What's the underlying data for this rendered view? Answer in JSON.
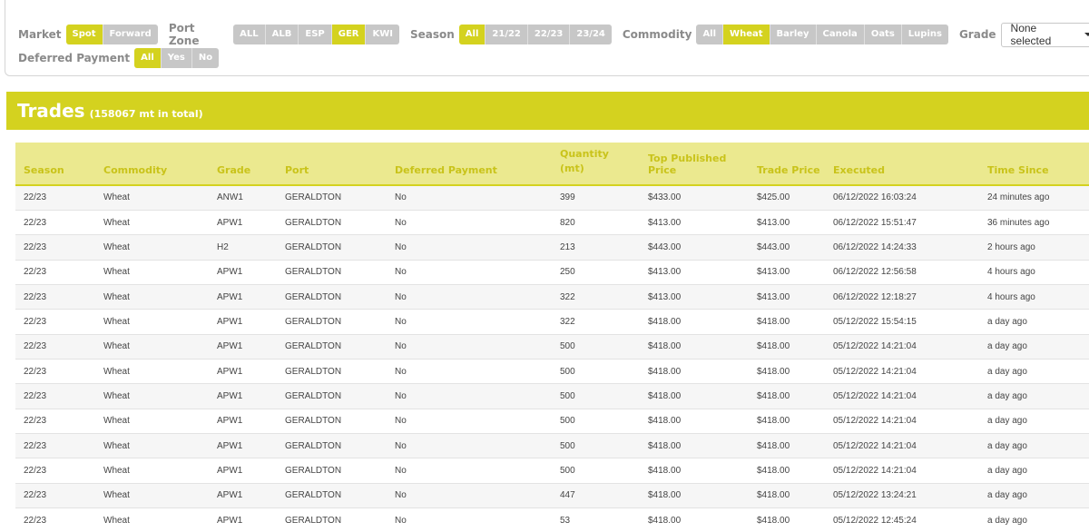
{
  "filters": {
    "market": {
      "label": "Market",
      "options": [
        "Spot",
        "Forward"
      ],
      "active": "Spot"
    },
    "port_zone": {
      "label": "Port Zone",
      "options": [
        "ALL",
        "ALB",
        "ESP",
        "GER",
        "KWI"
      ],
      "active": "GER"
    },
    "season": {
      "label": "Season",
      "options": [
        "All",
        "21/22",
        "22/23",
        "23/24"
      ],
      "active": "All"
    },
    "commodity": {
      "label": "Commodity",
      "options": [
        "All",
        "Wheat",
        "Barley",
        "Canola",
        "Oats",
        "Lupins"
      ],
      "active": "Wheat"
    },
    "grade": {
      "label": "Grade",
      "selected": "None selected"
    },
    "deferred_payment": {
      "label": "Deferred Payment",
      "options": [
        "All",
        "Yes",
        "No"
      ],
      "active": "All"
    }
  },
  "trades": {
    "title": "Trades",
    "subtitle": "(158067 mt in total)",
    "columns": [
      "Season",
      "Commodity",
      "Grade",
      "Port",
      "Deferred Payment",
      "Quantity (mt)",
      "Top Published Price",
      "Trade Price",
      "Executed",
      "Time Since"
    ],
    "rows": [
      [
        "22/23",
        "Wheat",
        "ANW1",
        "GERALDTON",
        "No",
        "399",
        "$433.00",
        "$425.00",
        "06/12/2022 16:03:24",
        "24 minutes ago"
      ],
      [
        "22/23",
        "Wheat",
        "APW1",
        "GERALDTON",
        "No",
        "820",
        "$413.00",
        "$413.00",
        "06/12/2022 15:51:47",
        "36 minutes ago"
      ],
      [
        "22/23",
        "Wheat",
        "H2",
        "GERALDTON",
        "No",
        "213",
        "$443.00",
        "$443.00",
        "06/12/2022 14:24:33",
        "2 hours ago"
      ],
      [
        "22/23",
        "Wheat",
        "APW1",
        "GERALDTON",
        "No",
        "250",
        "$413.00",
        "$413.00",
        "06/12/2022 12:56:58",
        "4 hours ago"
      ],
      [
        "22/23",
        "Wheat",
        "APW1",
        "GERALDTON",
        "No",
        "322",
        "$413.00",
        "$413.00",
        "06/12/2022 12:18:27",
        "4 hours ago"
      ],
      [
        "22/23",
        "Wheat",
        "APW1",
        "GERALDTON",
        "No",
        "322",
        "$418.00",
        "$418.00",
        "05/12/2022 15:54:15",
        "a day ago"
      ],
      [
        "22/23",
        "Wheat",
        "APW1",
        "GERALDTON",
        "No",
        "500",
        "$418.00",
        "$418.00",
        "05/12/2022 14:21:04",
        "a day ago"
      ],
      [
        "22/23",
        "Wheat",
        "APW1",
        "GERALDTON",
        "No",
        "500",
        "$418.00",
        "$418.00",
        "05/12/2022 14:21:04",
        "a day ago"
      ],
      [
        "22/23",
        "Wheat",
        "APW1",
        "GERALDTON",
        "No",
        "500",
        "$418.00",
        "$418.00",
        "05/12/2022 14:21:04",
        "a day ago"
      ],
      [
        "22/23",
        "Wheat",
        "APW1",
        "GERALDTON",
        "No",
        "500",
        "$418.00",
        "$418.00",
        "05/12/2022 14:21:04",
        "a day ago"
      ],
      [
        "22/23",
        "Wheat",
        "APW1",
        "GERALDTON",
        "No",
        "500",
        "$418.00",
        "$418.00",
        "05/12/2022 14:21:04",
        "a day ago"
      ],
      [
        "22/23",
        "Wheat",
        "APW1",
        "GERALDTON",
        "No",
        "500",
        "$418.00",
        "$418.00",
        "05/12/2022 14:21:04",
        "a day ago"
      ],
      [
        "22/23",
        "Wheat",
        "APW1",
        "GERALDTON",
        "No",
        "447",
        "$418.00",
        "$418.00",
        "05/12/2022 13:24:21",
        "a day ago"
      ],
      [
        "22/23",
        "Wheat",
        "APW1",
        "GERALDTON",
        "No",
        "53",
        "$418.00",
        "$418.00",
        "05/12/2022 12:45:24",
        "a day ago"
      ]
    ]
  },
  "colors": {
    "accent": "#d4d21f",
    "header_row_bg": "#ebe98f",
    "header_text": "#c9c31a",
    "inactive_button": "#c7c7c7"
  }
}
